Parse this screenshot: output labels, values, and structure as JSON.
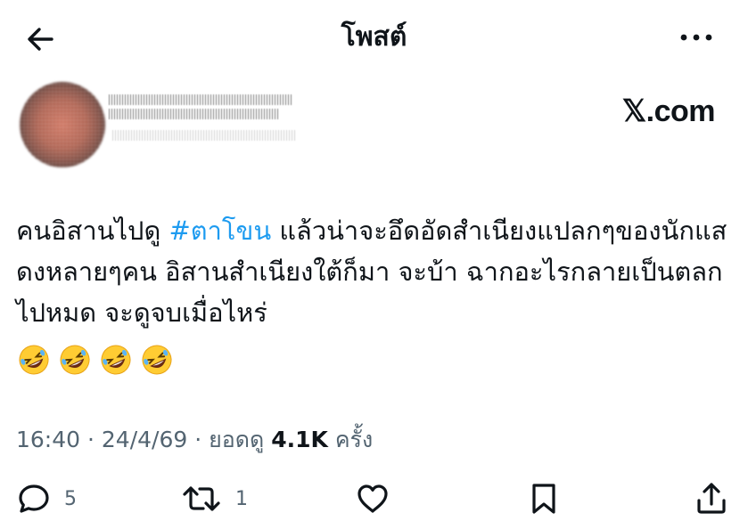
{
  "header": {
    "title": "โพสต์",
    "back_icon": "arrow-left-icon",
    "more_icon": "more-horizontal-icon"
  },
  "author": {
    "name": "",
    "handle": ""
  },
  "brand": "𝕏.com",
  "post": {
    "text_part1": "คนอิสานไปดู ",
    "hashtag": "#ตาโขน",
    "text_part2": " แล้วน่าจะอึดอัดสำเนียงแปลกๆของนักแสดงหลายๆคน อิสานสำเนียงใต้ก็มา จะบ้า ฉากอะไรกลายเป็นตลกไปหมด จะดูจบเมื่อไหร่",
    "emojis": [
      "🤣",
      "🤣",
      "🤣",
      "🤣"
    ]
  },
  "meta": {
    "time": "16:40",
    "sep1": " · ",
    "date": "24/4/69",
    "sep2": " · ",
    "views_label_prefix": "ยอดดู ",
    "views_count": "4.1K",
    "views_label_suffix": " ครั้ง"
  },
  "actions": {
    "reply_count": "5",
    "repost_count": "1",
    "like_count": "",
    "bookmark_count": "",
    "share_count": ""
  },
  "colors": {
    "accent": "#1d9bf0",
    "text": "#0f1419",
    "muted": "#536471"
  }
}
